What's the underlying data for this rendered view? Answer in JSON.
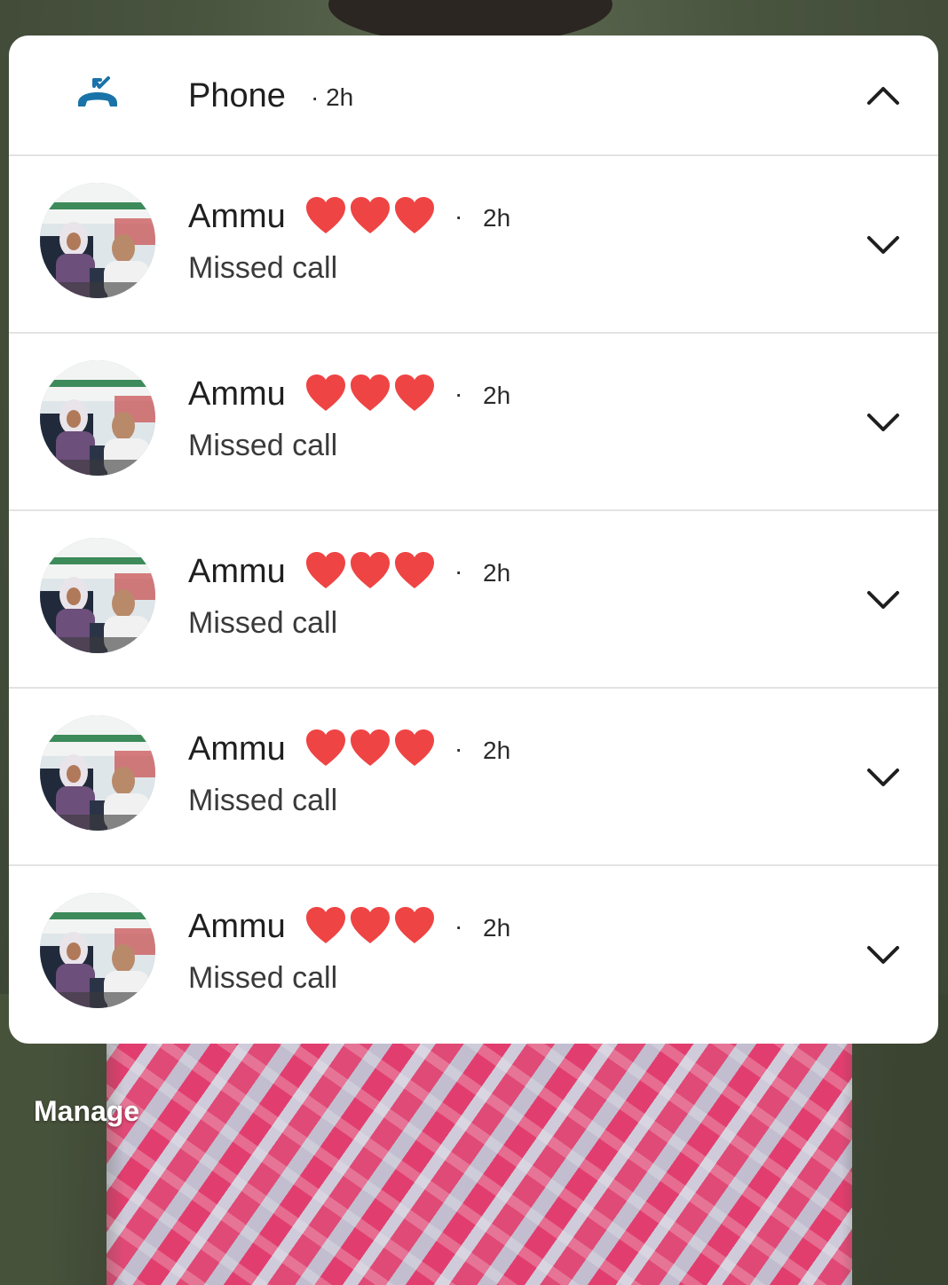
{
  "notification_group": {
    "app_name": "Phone",
    "app_time": "· 2h",
    "app_icon": "missed-call-icon",
    "expand_icon": "chevron-up-icon",
    "accent_color": "#1a73a8"
  },
  "notifications": [
    {
      "name": "Ammu",
      "emoji": "❤❤❤",
      "dot": "·",
      "time": "2h",
      "status": "Missed call",
      "avatar": "contact-photo",
      "chevron": "chevron-down-icon"
    },
    {
      "name": "Ammu",
      "emoji": "❤❤❤",
      "dot": "·",
      "time": "2h",
      "status": "Missed call",
      "avatar": "contact-photo",
      "chevron": "chevron-down-icon"
    },
    {
      "name": "Ammu",
      "emoji": "❤❤❤",
      "dot": "·",
      "time": "2h",
      "status": "Missed call",
      "avatar": "contact-photo",
      "chevron": "chevron-down-icon"
    },
    {
      "name": "Ammu",
      "emoji": "❤❤❤",
      "dot": "·",
      "time": "2h",
      "status": "Missed call",
      "avatar": "contact-photo",
      "chevron": "chevron-down-icon"
    },
    {
      "name": "Ammu",
      "emoji": "❤❤❤",
      "dot": "·",
      "time": "2h",
      "status": "Missed call",
      "avatar": "contact-photo",
      "chevron": "chevron-down-icon"
    }
  ],
  "footer": {
    "manage_label": "Manage"
  },
  "colors": {
    "heart": "#ef4444",
    "panel": "#ffffff"
  }
}
